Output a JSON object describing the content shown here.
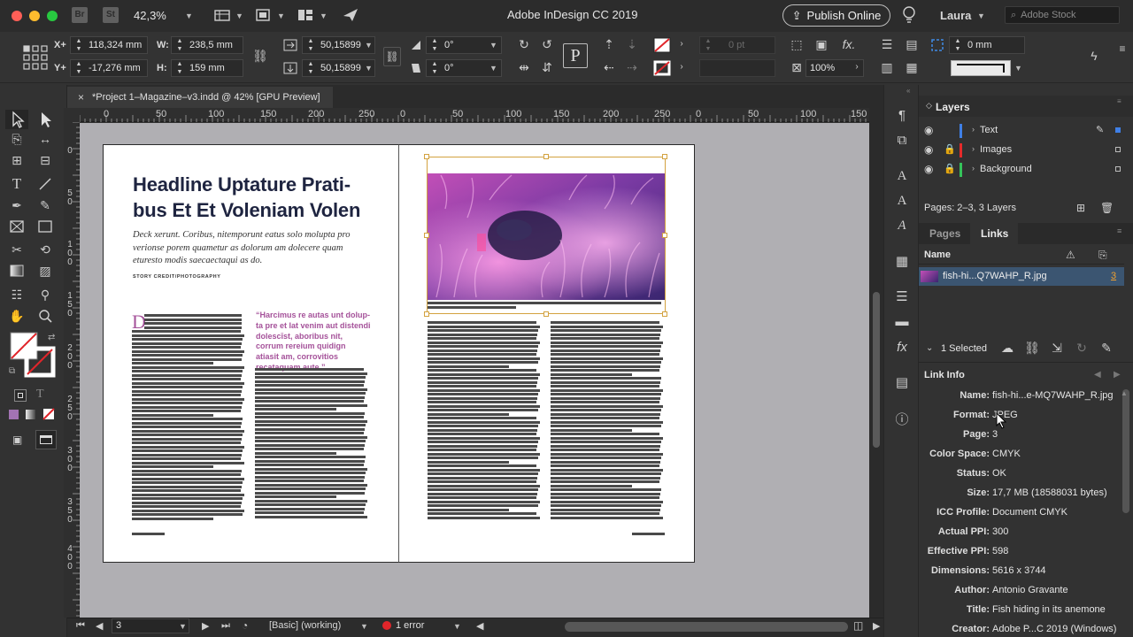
{
  "app": {
    "title": "Adobe InDesign CC 2019",
    "badges": [
      "Br",
      "St"
    ],
    "zoom": "42,3%",
    "publish_label": "Publish Online",
    "user": "Laura",
    "stock_placeholder": "Adobe Stock"
  },
  "control": {
    "x_label": "X+",
    "y_label": "Y+",
    "x_value": "118,324 mm",
    "y_value": "-17,276 mm",
    "w_label": "W:",
    "h_label": "H:",
    "w_value": "238,5 mm",
    "h_value": "159 mm",
    "scale_x": "50,15899",
    "scale_y": "50,15899",
    "rotation": "0°",
    "shear": "0°",
    "stroke_weight": "0 pt",
    "opacity": "100%",
    "offset": "0 mm"
  },
  "document": {
    "tab_title": "*Project 1–Magazine–v3.indd @ 42% [GPU Preview]"
  },
  "ruler": {
    "h_labels": [
      "0",
      "50",
      "100",
      "150",
      "200",
      "250",
      "0",
      "50",
      "100",
      "150",
      "200",
      "250",
      "0",
      "50",
      "100",
      "150"
    ],
    "v_labels": [
      "0",
      "5\n0",
      "1\n0\n0",
      "1\n5\n0",
      "2\n0\n0",
      "2\n5\n0",
      "3\n0\n0",
      "3\n5\n0",
      "4\n0\n0"
    ]
  },
  "spread": {
    "headline": "Headline Uptature Prati­bus Et Et Voleniam Volen",
    "deck": "Deck xerunt. Coribus, nitemporunt eatus solo molupta pro verionse porem quametur as dolorum am dolecere quam eturesto modis saecaectaqui as do.",
    "credit": "STORY CREDIT/PHOTOGRAPHY",
    "dropcap": "D",
    "pullquote": "“Harcimus re autas unt dolup­ta pre et lat venim aut distendi dolescīst, aboribus nit, corrum rereium quidign atiasit am, cor­rovitios recataquam aute.”"
  },
  "layers": {
    "title": "Layers",
    "items": [
      {
        "name": "Text",
        "color": "#3f7fe6"
      },
      {
        "name": "Images",
        "color": "#e62a2a"
      },
      {
        "name": "Background",
        "color": "#35c35a"
      }
    ],
    "footer": "Pages: 2–3, 3 Layers"
  },
  "tabs": {
    "pages": "Pages",
    "links": "Links"
  },
  "links": {
    "name_header": "Name",
    "file": "fish-hi...Q7WAHP_R.jpg",
    "page": "3",
    "selected": "1 Selected",
    "info_title": "Link Info"
  },
  "link_info": [
    {
      "label": "Name:",
      "value": "fish-hi...e-MQ7WAHP_R.jpg"
    },
    {
      "label": "Format:",
      "value": "JPEG"
    },
    {
      "label": "Page:",
      "value": "3"
    },
    {
      "label": "Color Space:",
      "value": "CMYK"
    },
    {
      "label": "Status:",
      "value": "OK"
    },
    {
      "label": "Size:",
      "value": "17,7 MB (18588031 bytes)"
    },
    {
      "label": "ICC Profile:",
      "value": "Document CMYK"
    },
    {
      "label": "Actual PPI:",
      "value": "300"
    },
    {
      "label": "Effective PPI:",
      "value": "598"
    },
    {
      "label": "Dimensions:",
      "value": "5616 x 3744"
    },
    {
      "label": "Author:",
      "value": "Antonio Gravante"
    },
    {
      "label": "Title:",
      "value": "Fish hiding in its anemone"
    },
    {
      "label": "Creator:",
      "value": "Adobe P...C 2019 (Windows)"
    }
  ],
  "status": {
    "page": "3",
    "style": "[Basic] (working)",
    "errors": "1 error"
  },
  "colors": {
    "accent_purple": "#a5529a",
    "selection_blue": "#3b5571",
    "error_red": "#e0252a",
    "frame_gold": "#d3a23f"
  }
}
